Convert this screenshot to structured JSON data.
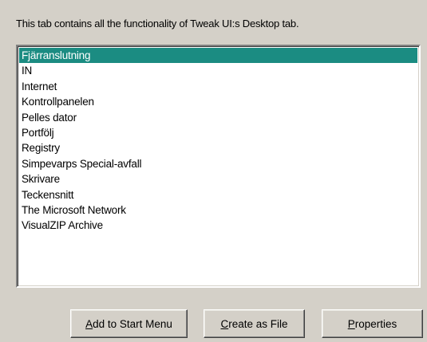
{
  "description": "This tab contains all the functionality of Tweak UI:s Desktop tab.",
  "list": {
    "selected_index": 0,
    "items": [
      "Fjärranslutning",
      "IN",
      "Internet",
      "Kontrollpanelen",
      "Pelles dator",
      "Portfölj",
      "Registry",
      "Simpevarps Special-avfall",
      "Skrivare",
      "Teckensnitt",
      "The Microsoft Network",
      "VisualZIP Archive"
    ]
  },
  "buttons": {
    "add_to_start_menu": {
      "mnemonic": "A",
      "rest": "dd to Start Menu"
    },
    "create_as_file": {
      "mnemonic": "C",
      "rest": "reate as File"
    },
    "properties": {
      "mnemonic": "P",
      "rest": "roperties"
    }
  },
  "colors": {
    "selection": "#1b8c82",
    "face": "#d4d0c8"
  }
}
